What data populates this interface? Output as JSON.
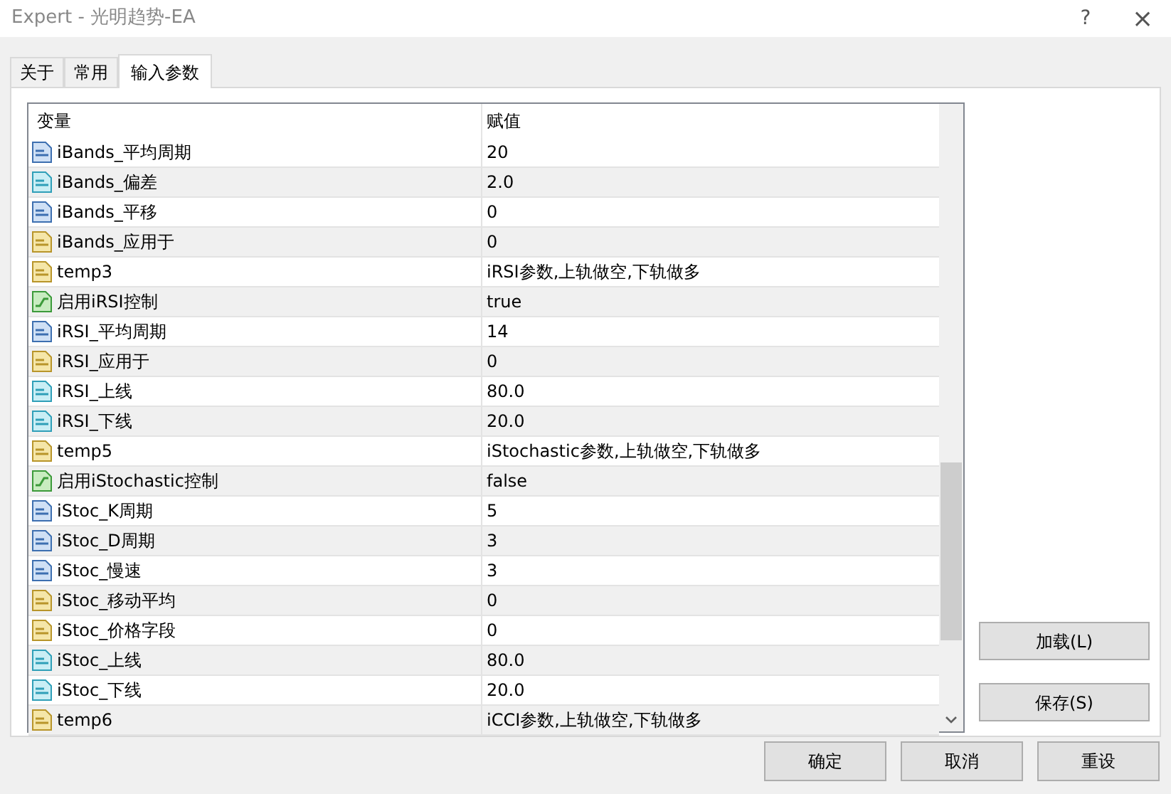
{
  "window": {
    "title": "Expert - 光明趋势-EA",
    "help": "?",
    "close": "×"
  },
  "tabs": [
    {
      "label": "关于",
      "selected": false
    },
    {
      "label": "常用",
      "selected": false
    },
    {
      "label": "输入参数",
      "selected": true
    }
  ],
  "table": {
    "columns": [
      "变量",
      "赋值"
    ],
    "rows": [
      {
        "kind": "int",
        "name": "iBands_平均周期",
        "value": "20"
      },
      {
        "kind": "double",
        "name": "iBands_偏差",
        "value": "2.0"
      },
      {
        "kind": "int",
        "name": "iBands_平移",
        "value": "0"
      },
      {
        "kind": "string",
        "name": "iBands_应用于",
        "value": "0"
      },
      {
        "kind": "string",
        "name": "temp3",
        "value": "iRSI参数,上轨做空,下轨做多"
      },
      {
        "kind": "bool",
        "name": "启用iRSI控制",
        "value": "true"
      },
      {
        "kind": "int",
        "name": "iRSI_平均周期",
        "value": "14"
      },
      {
        "kind": "string",
        "name": "iRSI_应用于",
        "value": "0"
      },
      {
        "kind": "double",
        "name": "iRSI_上线",
        "value": "80.0"
      },
      {
        "kind": "double",
        "name": "iRSI_下线",
        "value": "20.0"
      },
      {
        "kind": "string",
        "name": "temp5",
        "value": "iStochastic参数,上轨做空,下轨做多"
      },
      {
        "kind": "bool",
        "name": "启用iStochastic控制",
        "value": "false"
      },
      {
        "kind": "int",
        "name": "iStoc_K周期",
        "value": "5"
      },
      {
        "kind": "int",
        "name": "iStoc_D周期",
        "value": "3"
      },
      {
        "kind": "int",
        "name": "iStoc_慢速",
        "value": "3"
      },
      {
        "kind": "string",
        "name": "iStoc_移动平均",
        "value": "0"
      },
      {
        "kind": "string",
        "name": "iStoc_价格字段",
        "value": "0"
      },
      {
        "kind": "double",
        "name": "iStoc_上线",
        "value": "80.0"
      },
      {
        "kind": "double",
        "name": "iStoc_下线",
        "value": "20.0"
      },
      {
        "kind": "string",
        "name": "temp6",
        "value": "iCCI参数,上轨做空,下轨做多"
      }
    ]
  },
  "side_buttons": [
    "加载(L)",
    "保存(S)"
  ],
  "footer_buttons": [
    "确定",
    "取消",
    "重设"
  ]
}
